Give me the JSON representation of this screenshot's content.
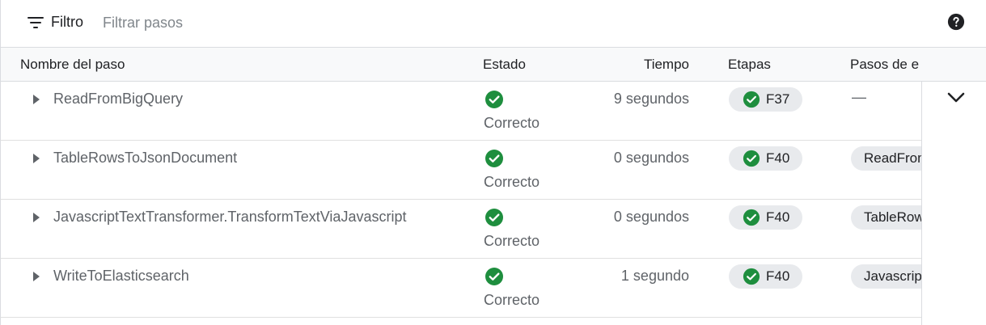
{
  "filter": {
    "label": "Filtro",
    "placeholder": "Filtrar pasos",
    "value": ""
  },
  "table": {
    "headers": {
      "step_name": "Nombre del paso",
      "status": "Estado",
      "time": "Tiempo",
      "stages": "Etapas",
      "input_steps": "Pasos de e"
    },
    "rows": [
      {
        "name": "ReadFromBigQuery",
        "status": "Correcto",
        "time": "9 segundos",
        "stage": "F37",
        "input": "—"
      },
      {
        "name": "TableRowsToJsonDocument",
        "status": "Correcto",
        "time": "0 segundos",
        "stage": "F40",
        "input": "ReadFrom"
      },
      {
        "name": "JavascriptTextTransformer.TransformTextViaJavascript",
        "status": "Correcto",
        "time": "0 segundos",
        "stage": "F40",
        "input": "TableRow"
      },
      {
        "name": "WriteToElasticsearch",
        "status": "Correcto",
        "time": "1 segundo",
        "stage": "F40",
        "input": "Javascrip"
      }
    ]
  },
  "icons": {
    "filter": "filter-icon",
    "help": "help-icon",
    "expand": "expand-arrow-icon",
    "status": "check-circle-icon",
    "collapse": "chevron-down-icon"
  },
  "colors": {
    "success": "#1e8e3e",
    "chip_bg": "#e8eaed",
    "header_bg": "#f8f9fa"
  }
}
